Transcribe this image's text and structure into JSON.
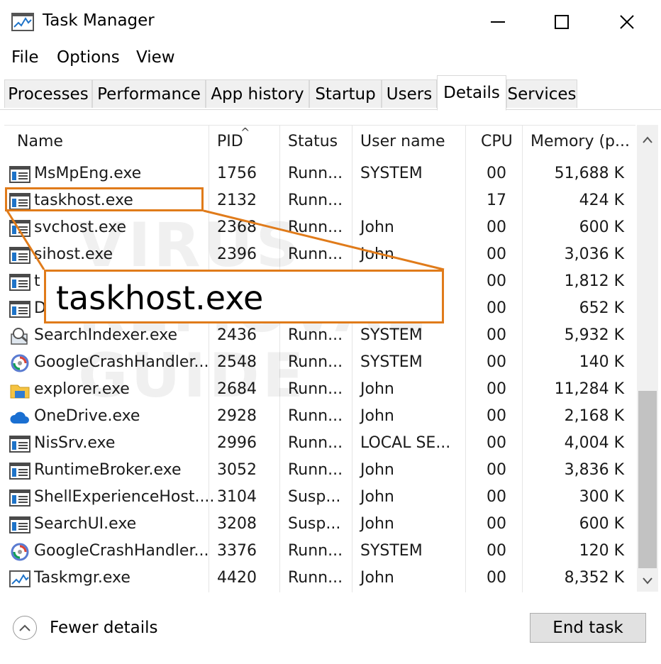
{
  "window": {
    "title": "Task Manager",
    "minimize_icon": "minimize-icon",
    "maximize_icon": "maximize-icon",
    "close_icon": "close-icon"
  },
  "menu": {
    "items": [
      "File",
      "Options",
      "View"
    ]
  },
  "tabs": {
    "items": [
      "Processes",
      "Performance",
      "App history",
      "Startup",
      "Users",
      "Details",
      "Services"
    ],
    "active": "Details"
  },
  "columns": {
    "name": "Name",
    "pid": "PID",
    "status": "Status",
    "user": "User name",
    "cpu": "CPU",
    "memory": "Memory (p..."
  },
  "processes": [
    {
      "name": "MsMpEng.exe",
      "pid": "1756",
      "status": "Runn...",
      "user": "SYSTEM",
      "cpu": "00",
      "memory": "51,688 K",
      "icon": "app-window-icon"
    },
    {
      "name": "taskhost.exe",
      "pid": "2132",
      "status": "Runn...",
      "user": "",
      "cpu": "17",
      "memory": "424 K",
      "icon": "app-window-icon"
    },
    {
      "name": "svchost.exe",
      "pid": "2368",
      "status": "Runn...",
      "user": "John",
      "cpu": "00",
      "memory": "600 K",
      "icon": "app-window-icon"
    },
    {
      "name": "sihost.exe",
      "pid": "2396",
      "status": "Runn...",
      "user": "John",
      "cpu": "00",
      "memory": "3,036 K",
      "icon": "app-window-icon"
    },
    {
      "name": "t",
      "pid": "",
      "status": "",
      "user": "",
      "cpu": "00",
      "memory": "1,812 K",
      "icon": "app-window-icon"
    },
    {
      "name": "D",
      "pid": "",
      "status": "",
      "user": "",
      "cpu": "00",
      "memory": "652 K",
      "icon": "app-window-icon"
    },
    {
      "name": "SearchIndexer.exe",
      "pid": "2436",
      "status": "Runn...",
      "user": "SYSTEM",
      "cpu": "00",
      "memory": "5,932 K",
      "icon": "search-indexer-icon"
    },
    {
      "name": "GoogleCrashHandler...",
      "pid": "2548",
      "status": "Runn...",
      "user": "SYSTEM",
      "cpu": "00",
      "memory": "140 K",
      "icon": "google-update-icon"
    },
    {
      "name": "explorer.exe",
      "pid": "2684",
      "status": "Runn...",
      "user": "John",
      "cpu": "00",
      "memory": "11,284 K",
      "icon": "folder-icon"
    },
    {
      "name": "OneDrive.exe",
      "pid": "2928",
      "status": "Runn...",
      "user": "John",
      "cpu": "00",
      "memory": "2,168 K",
      "icon": "cloud-icon"
    },
    {
      "name": "NisSrv.exe",
      "pid": "2996",
      "status": "Runn...",
      "user": "LOCAL SE...",
      "cpu": "00",
      "memory": "4,004 K",
      "icon": "app-window-icon"
    },
    {
      "name": "RuntimeBroker.exe",
      "pid": "3052",
      "status": "Runn...",
      "user": "John",
      "cpu": "00",
      "memory": "3,836 K",
      "icon": "app-window-icon"
    },
    {
      "name": "ShellExperienceHost....",
      "pid": "3104",
      "status": "Susp...",
      "user": "John",
      "cpu": "00",
      "memory": "300 K",
      "icon": "app-window-icon"
    },
    {
      "name": "SearchUI.exe",
      "pid": "3208",
      "status": "Susp...",
      "user": "John",
      "cpu": "00",
      "memory": "600 K",
      "icon": "app-window-icon"
    },
    {
      "name": "GoogleCrashHandler...",
      "pid": "3376",
      "status": "Runn...",
      "user": "SYSTEM",
      "cpu": "00",
      "memory": "120 K",
      "icon": "google-update-icon"
    },
    {
      "name": "Taskmgr.exe",
      "pid": "4420",
      "status": "Runn...",
      "user": "John",
      "cpu": "00",
      "memory": "8,352 K",
      "icon": "task-manager-icon"
    }
  ],
  "callout": {
    "text": "taskhost.exe",
    "color": "#e07b1a"
  },
  "watermark": {
    "lines": [
      "VIRUS",
      "REMOVAL",
      "GUIDE"
    ]
  },
  "footer": {
    "fewer_details": "Fewer details",
    "end_task": "End task"
  }
}
